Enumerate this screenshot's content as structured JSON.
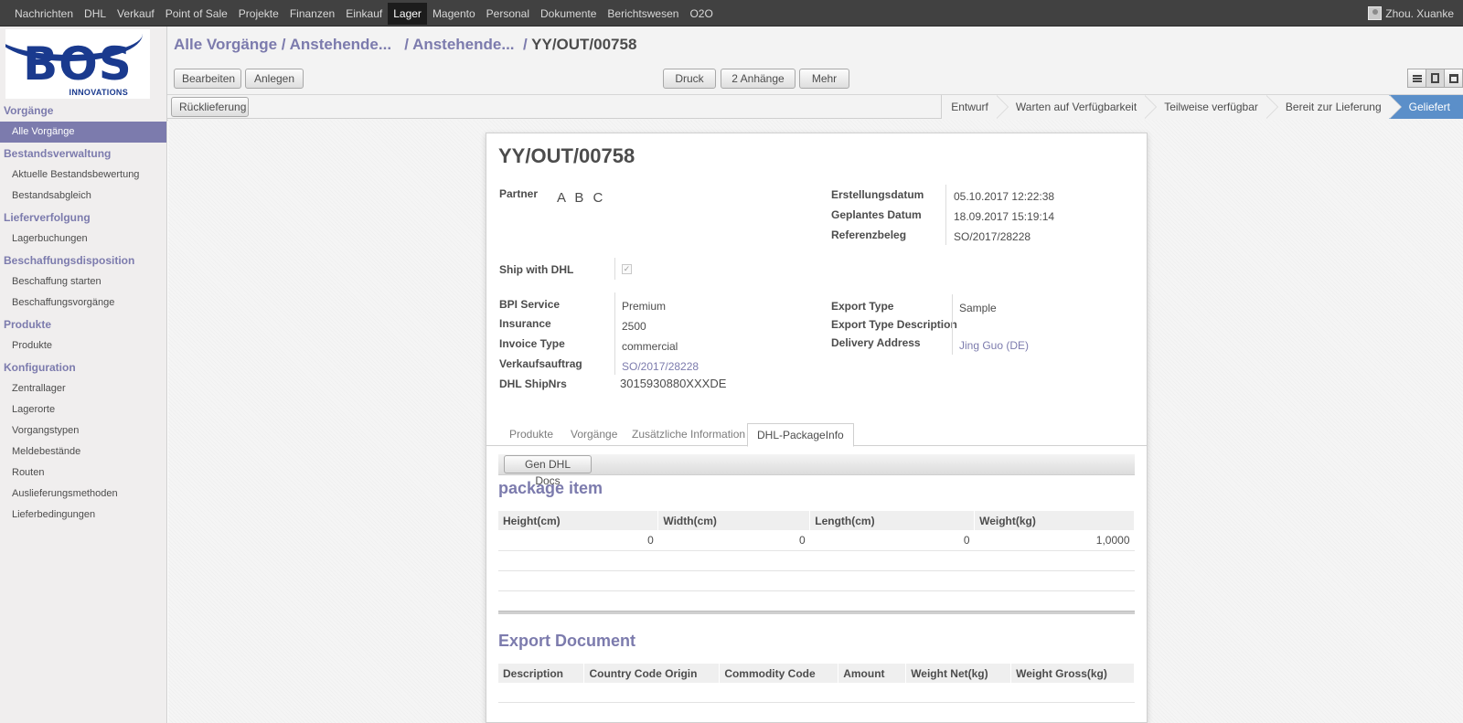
{
  "topbar": {
    "menu": [
      "Nachrichten",
      "DHL",
      "Verkauf",
      "Point of Sale",
      "Projekte",
      "Finanzen",
      "Einkauf",
      "Lager",
      "Magento",
      "Personal",
      "Dokumente",
      "Berichtswesen",
      "O2O"
    ],
    "active_menu": "Lager",
    "user": "Zhou. Xuanke"
  },
  "logo": {
    "name": "BOS",
    "tagline": "INNOVATIONS"
  },
  "sidebar": {
    "sections": [
      {
        "title": "Vorgänge",
        "items": [
          "Alle Vorgänge"
        ]
      },
      {
        "title": "Bestandsverwaltung",
        "items": [
          "Aktuelle Bestandsbewertung",
          "Bestandsabgleich"
        ]
      },
      {
        "title": "Lieferverfolgung",
        "items": [
          "Lagerbuchungen"
        ]
      },
      {
        "title": "Beschaffungsdisposition",
        "items": [
          "Beschaffung starten",
          "Beschaffungsvorgänge"
        ]
      },
      {
        "title": "Produkte",
        "items": [
          "Produkte"
        ]
      },
      {
        "title": "Konfiguration",
        "items": [
          "Zentrallager",
          "Lagerorte",
          "Vorgangstypen",
          "Meldebestände",
          "Routen",
          "Auslieferungsmethoden",
          "Lieferbedingungen"
        ]
      }
    ],
    "active_item": "Alle Vorgänge"
  },
  "breadcrumb": {
    "b1": "Alle Vorgänge",
    "b2": "Anstehende...",
    "b3": "Anstehende...",
    "current": "YY/OUT/00758",
    "sep": " / "
  },
  "buttons": {
    "edit": "Bearbeiten",
    "create": "Anlegen",
    "print": "Druck",
    "attachments": "2 Anhänge",
    "more": "Mehr",
    "return": "Rücklieferung",
    "gen_dhl": "Gen DHL Docs"
  },
  "stages": [
    "Entwurf",
    "Warten auf Verfügbarkeit",
    "Teilweise verfügbar",
    "Bereit zur Lieferung",
    "Geliefert"
  ],
  "active_stage": "Geliefert",
  "record": {
    "title": "YY/OUT/00758",
    "partner_label": "Partner",
    "partner_value": "A B C",
    "erstellungsdatum_label": "Erstellungsdatum",
    "erstellungsdatum_value": "05.10.2017 12:22:38",
    "geplantes_label": "Geplantes Datum",
    "geplantes_value": "18.09.2017 15:19:14",
    "referenz_label": "Referenzbeleg",
    "referenz_value": "SO/2017/28228",
    "ship_dhl_label": "Ship with DHL",
    "ship_dhl_checked": true,
    "bpi_label": "BPI Service",
    "bpi_value": "Premium",
    "insurance_label": "Insurance",
    "insurance_value": "2500",
    "invoice_type_label": "Invoice Type",
    "invoice_type_value": "commercial",
    "verkaufsauftrag_label": "Verkaufsauftrag",
    "verkaufsauftrag_value": "SO/2017/28228",
    "dhl_shipnrs_label": "DHL ShipNrs",
    "dhl_shipnrs_value": "3015930880XXXDE",
    "export_type_label": "Export Type",
    "export_type_value": "Sample",
    "export_type_desc_label": "Export Type Description",
    "export_type_desc_value": "",
    "delivery_address_label": "Delivery Address",
    "delivery_address_value": "Jing Guo (DE)"
  },
  "tabs": [
    "Produkte",
    "Vorgänge",
    "Zusätzliche Information",
    "DHL-PackageInfo"
  ],
  "active_tab": "DHL-PackageInfo",
  "package": {
    "title": "package item",
    "headers": [
      "Height(cm)",
      "Width(cm)",
      "Length(cm)",
      "Weight(kg)"
    ],
    "rows": [
      [
        "0",
        "0",
        "0",
        "1,0000"
      ]
    ]
  },
  "export_doc": {
    "title": "Export Document",
    "headers": [
      "Description",
      "Country Code Origin",
      "Commodity Code",
      "Amount",
      "Weight Net(kg)",
      "Weight Gross(kg)"
    ]
  }
}
